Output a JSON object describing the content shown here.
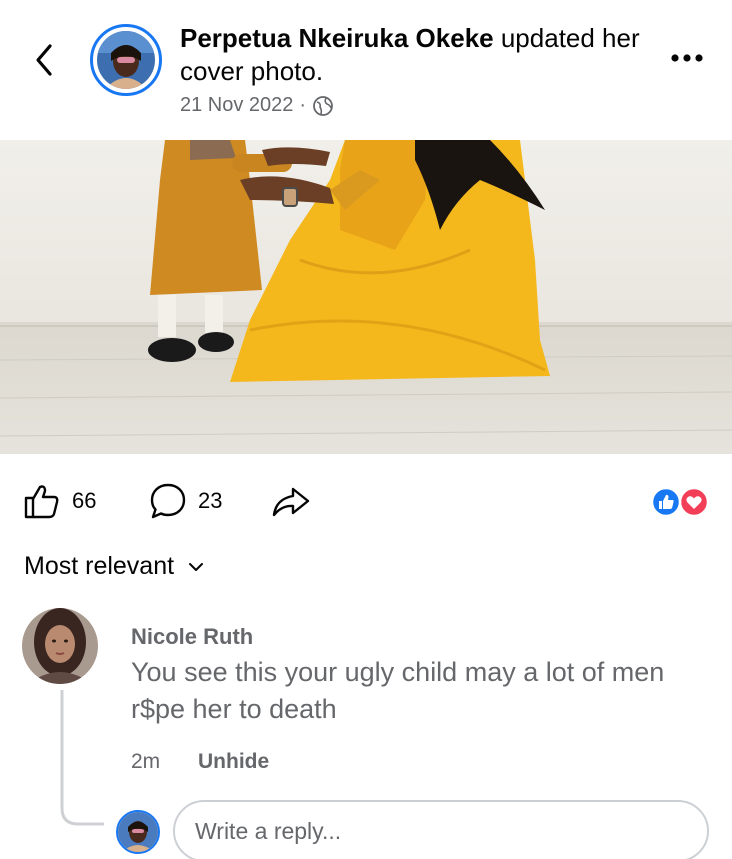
{
  "header": {
    "name": "Perpetua Nkeiruka Okeke",
    "action": " updated her cover photo.",
    "date": "21 Nov 2022",
    "separator": "·",
    "privacy_icon": "globe-icon",
    "back_icon": "chevron-left-icon",
    "more_icon": "more-horizontal-icon"
  },
  "photo": {
    "kind": "cover-photo"
  },
  "actions": {
    "likes": "66",
    "comments": "23",
    "like_icon": "thumbs-up-icon",
    "comment_icon": "comment-bubble-icon",
    "share_icon": "share-arrow-icon",
    "reaction_icons": [
      "like-reaction-icon",
      "love-reaction-icon"
    ]
  },
  "sort": {
    "label": "Most relevant",
    "icon": "chevron-down-icon"
  },
  "comment": {
    "author": "Nicole Ruth",
    "text": "You see this your ugly child may a lot of men r$pe her to death",
    "time": "2m",
    "action": "Unhide"
  },
  "reply": {
    "placeholder": "Write a reply..."
  },
  "colors": {
    "accent": "#1877f2",
    "love": "#f33e58",
    "secondary_text": "#65676b",
    "dress": "#f5b81c"
  }
}
